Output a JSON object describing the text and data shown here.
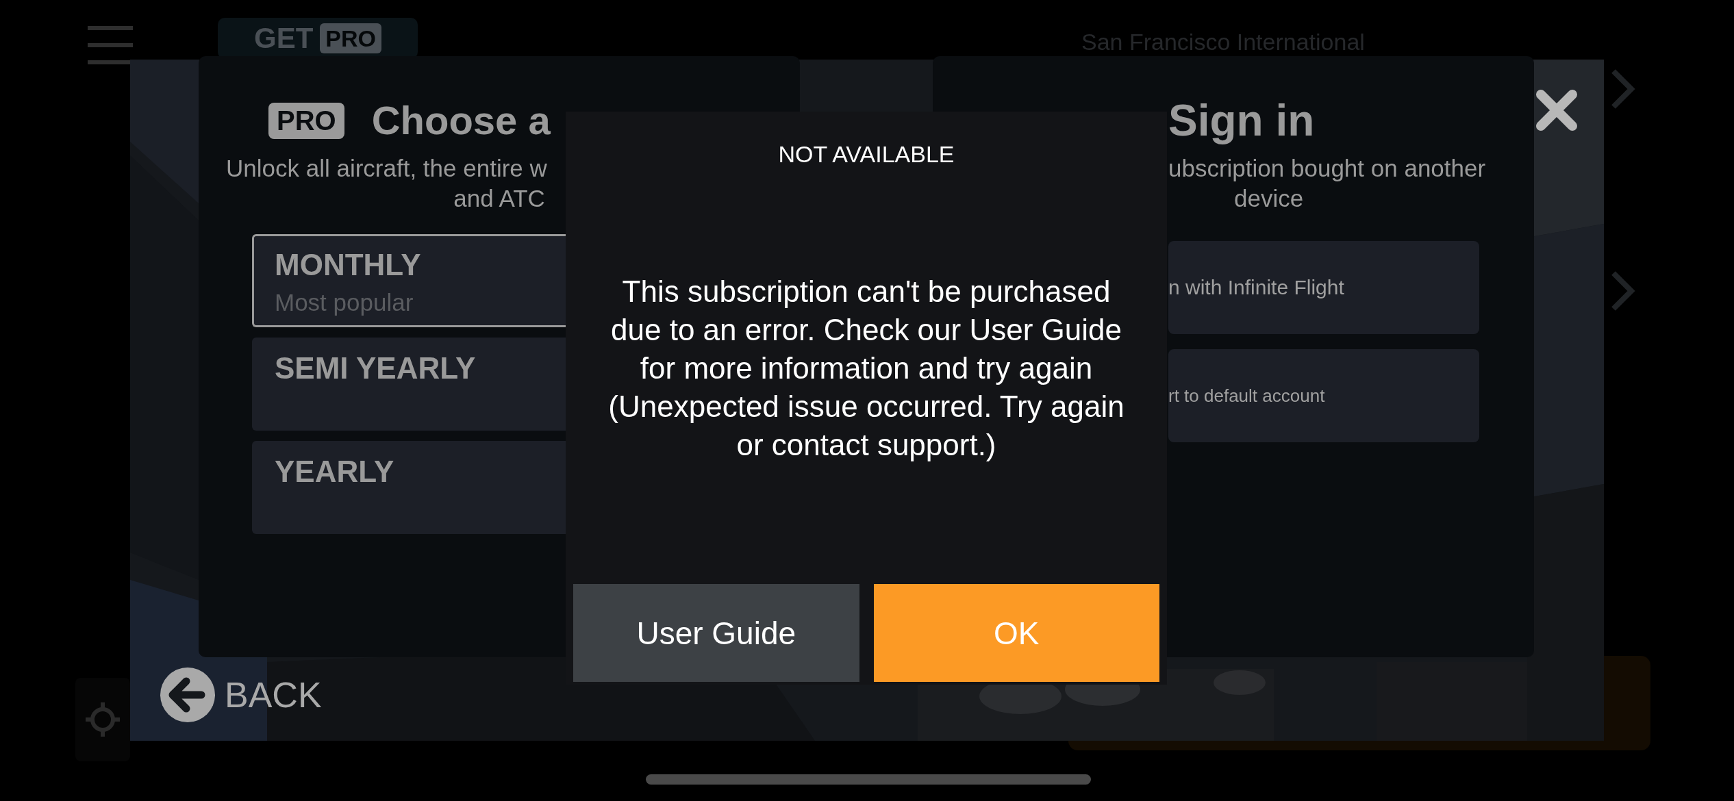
{
  "background": {
    "get_pro_button": {
      "label": "GET",
      "badge": "PRO"
    },
    "airport": "San Francisco International"
  },
  "plan_panel": {
    "badge": "PRO",
    "title": "Choose a",
    "subtitle_lines": [
      "Unlock all aircraft, the entire w",
      "and ATC"
    ],
    "plans": [
      {
        "name": "MONTHLY",
        "note": "Most popular",
        "selected": true
      },
      {
        "name": "SEMI YEARLY",
        "selected": false
      },
      {
        "name": "YEARLY",
        "selected": false
      }
    ]
  },
  "signin_panel": {
    "title": "Sign in",
    "subtitle_lines": [
      "ubscription bought on another",
      "device"
    ],
    "buttons": [
      "n with Infinite Flight",
      "rt to default account"
    ]
  },
  "dialog": {
    "title": "NOT AVAILABLE",
    "message": "This subscription can't be purchased due to an error. Check our User Guide for more information and try again (Unexpected issue occurred. Try again or contact support.)",
    "buttons": [
      {
        "label": "User Guide",
        "kind": "secondary"
      },
      {
        "label": "OK",
        "kind": "primary"
      }
    ]
  },
  "back_button": {
    "label": "BACK"
  }
}
